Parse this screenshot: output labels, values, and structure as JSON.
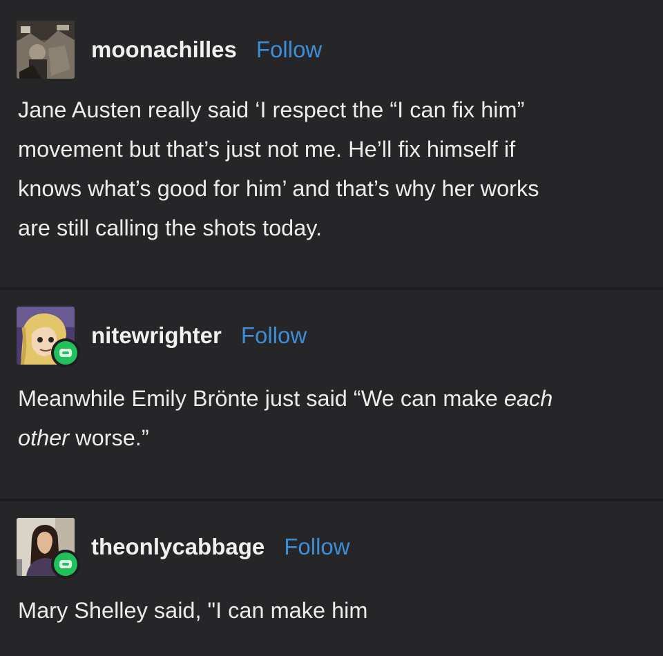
{
  "follow_label": "Follow",
  "accent_color": "#3d8ed8",
  "badge_color": "#21c05a",
  "posts": [
    {
      "username": "moonachilles",
      "avatar_icon": "avatar-photo-collage",
      "has_badge": false,
      "lines": [
        "Jane Austen really said ‘I respect the “I can fix him”",
        "movement but that’s just not me. He’ll fix himself if",
        "knows what’s good for him’ and that’s why her works",
        "are still calling the shots today."
      ]
    },
    {
      "username": "nitewrighter",
      "avatar_icon": "avatar-cartoon-blonde",
      "has_badge": true,
      "line1_a": "Meanwhile Emily Brönte just said “We can make ",
      "line1_em": "each",
      "line2_em": "other",
      "line2_b": " worse.”"
    },
    {
      "username": "theonlycabbage",
      "avatar_icon": "avatar-photo-woman",
      "has_badge": true,
      "lines": [
        "Mary Shelley said, \"I can make him"
      ]
    }
  ]
}
